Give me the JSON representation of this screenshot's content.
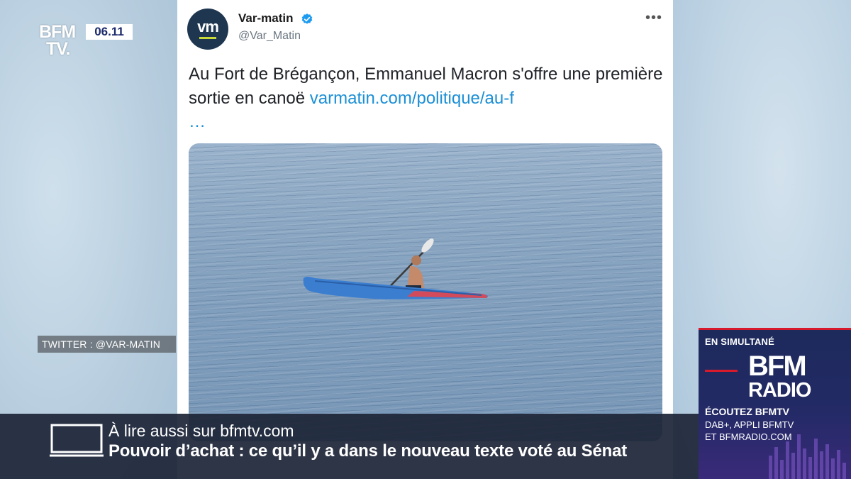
{
  "channel": {
    "logo_line1": "BFM",
    "logo_line2": "TV.",
    "clock": "06.11"
  },
  "source_tag": "TWITTER : @VAR-MATIN",
  "tweet": {
    "avatar_text": "vm",
    "account_name": "Var-matin",
    "handle": "@Var_Matin",
    "more_label": "•••",
    "text": "Au Fort de Brégançon, Emmanuel Macron s'offre une première sortie en canoë",
    "link": "varmatin.com/politique/au-f",
    "ellipsis": "…"
  },
  "banner": {
    "kicker": "À lire aussi sur bfmtv.com",
    "headline": "Pouvoir d’achat : ce qu’il y a dans le nouveau texte voté au Sénat"
  },
  "radio_promo": {
    "simulcast": "EN SIMULTANÉ",
    "brand_line1": "BFM",
    "brand_line2": "RADIO",
    "listen": "ÉCOUTEZ BFMTV",
    "line2": "DAB+, APPLI BFMTV",
    "line3": "ET BFMRADIO.COM"
  },
  "colors": {
    "link": "#1b8fd6",
    "banner_bg": "#1e2638",
    "radio_bg": "#232a66",
    "accent_red": "#d61a2b"
  }
}
